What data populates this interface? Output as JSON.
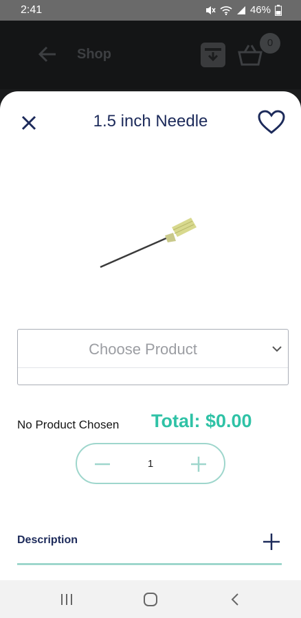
{
  "status_bar": {
    "time": "2:41",
    "battery": "46%",
    "icons": [
      "mute-icon",
      "wifi-icon",
      "signal-icon",
      "battery-icon"
    ]
  },
  "app_header": {
    "back_icon": "arrow-left-icon",
    "title": "Shop",
    "download_icon": "download-icon",
    "cart_icon": "cart-icon",
    "cart_count": "0"
  },
  "product": {
    "close_icon": "close-icon",
    "title": "1.5 inch Needle",
    "favorite_icon": "heart-icon",
    "image_icon": "needle-image"
  },
  "selector": {
    "placeholder": "Choose Product",
    "chevron_icon": "chevron-down-icon"
  },
  "summary": {
    "status": "No Product Chosen",
    "total": "Total: $0.00"
  },
  "quantity": {
    "minus_icon": "minus-icon",
    "value": "1",
    "plus_icon": "plus-icon"
  },
  "description": {
    "label": "Description",
    "expand_icon": "plus-icon"
  },
  "nav_bar": {
    "items": [
      "recent-apps-icon",
      "home-icon",
      "back-icon"
    ]
  },
  "colors": {
    "accent": "#2fc2a6",
    "accent_light": "#9ed6cc",
    "navy": "#1c2a5a",
    "placeholder": "#9b9da2"
  }
}
